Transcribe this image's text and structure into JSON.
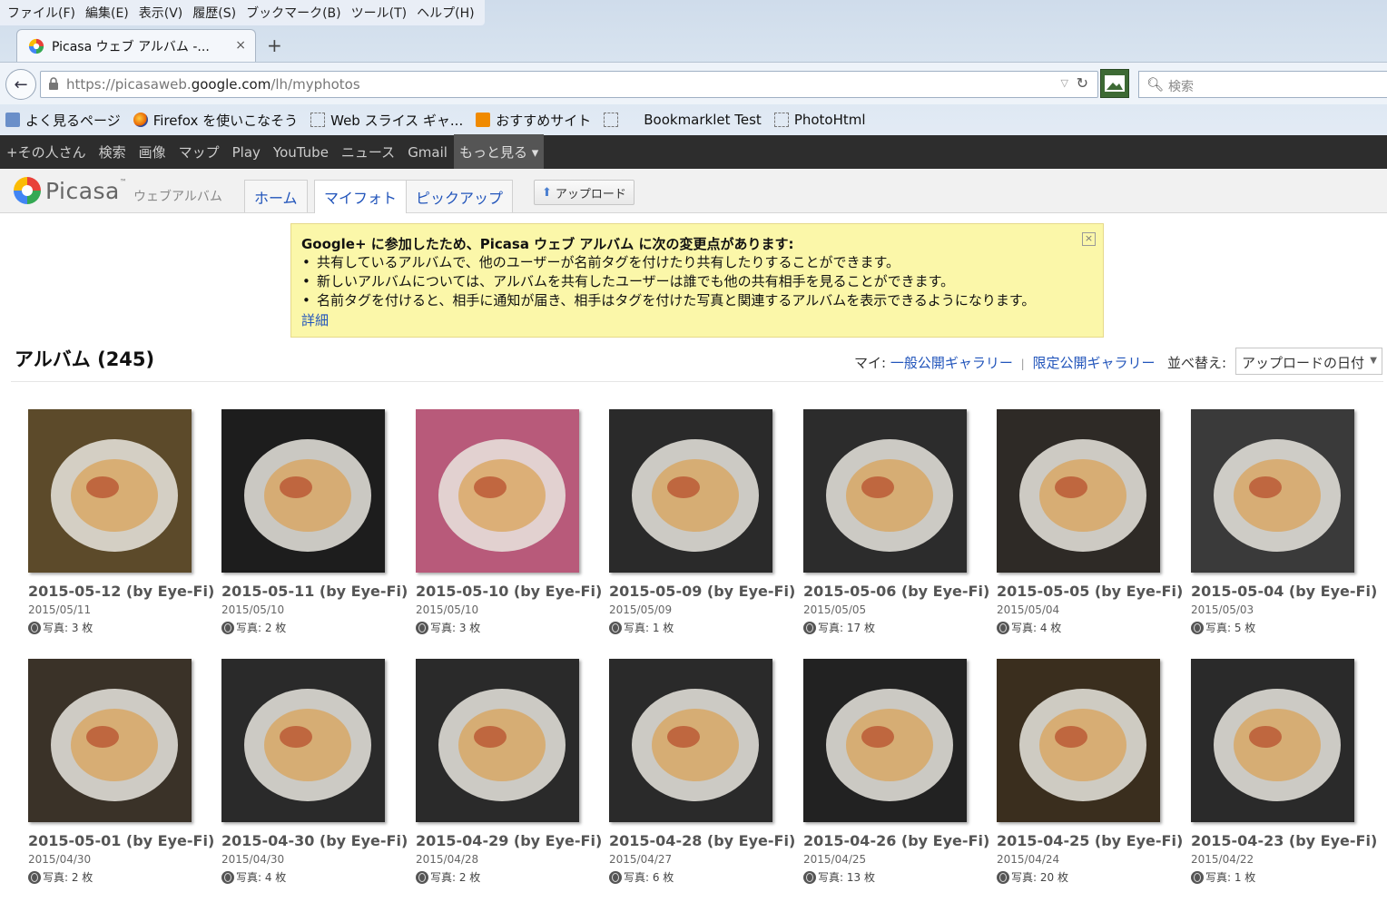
{
  "menubar": [
    "ファイル(F)",
    "編集(E)",
    "表示(V)",
    "履歴(S)",
    "ブックマーク(B)",
    "ツール(T)",
    "ヘルプ(H)"
  ],
  "tab": {
    "title": "Picasa ウェブ アルバム -...",
    "close": "×",
    "new": "+"
  },
  "nav": {
    "url_prefix": "https://picasaweb.",
    "url_domain": "google.com",
    "url_path": "/lh/myphotos",
    "search_placeholder": "検索",
    "back": "←",
    "reload": "↻",
    "dropdown": "▽"
  },
  "bookmarks": [
    "よく見るページ",
    "Firefox を使いこなそう",
    "Web スライス ギャ...",
    "おすすめサイト",
    "Bookmarklet Test",
    "PhotoHtml"
  ],
  "gbar": [
    "+その人さん",
    "検索",
    "画像",
    "マップ",
    "Play",
    "YouTube",
    "ニュース",
    "Gmail",
    "もっと見る ▾"
  ],
  "picasa": {
    "name": "Picasa",
    "tm": "™",
    "subtitle": "ウェブアルバム",
    "tabs": [
      "ホーム",
      "マイフォト",
      "ピックアップ"
    ],
    "upload": "アップロード"
  },
  "notice": {
    "title": "Google+ に参加したため、Picasa ウェブ アルバム に次の変更点があります:",
    "items": [
      "共有しているアルバムで、他のユーザーが名前タグを付けたり共有したりすることができます。",
      "新しいアルバムについては、アルバムを共有したユーザーは誰でも他の共有相手を見ることができます。",
      "名前タグを付けると、相手に通知が届き、相手はタグを付けた写真と関連するアルバムを表示できるようになります。"
    ],
    "link": "詳細",
    "close": "×"
  },
  "albums_header": {
    "title": "アルバム (245)",
    "my_label": "マイ:",
    "public_gallery": "一般公開ギャラリー",
    "sep": "|",
    "limited_gallery": "限定公開ギャラリー",
    "sort_label": "並べ替え:",
    "sort_value": "アップロードの日付",
    "sort_arrow": "▼"
  },
  "albums": [
    {
      "title": "2015-05-12 (by Eye-Fi)",
      "date": "2015/05/11",
      "count": "写真: 3 枚",
      "color": "#5c4a2a"
    },
    {
      "title": "2015-05-11 (by Eye-Fi)",
      "date": "2015/05/10",
      "count": "写真: 2 枚",
      "color": "#1d1d1d"
    },
    {
      "title": "2015-05-10 (by Eye-Fi)",
      "date": "2015/05/10",
      "count": "写真: 3 枚",
      "color": "#b85a7a"
    },
    {
      "title": "2015-05-09 (by Eye-Fi)",
      "date": "2015/05/09",
      "count": "写真: 1 枚",
      "color": "#2a2a2a"
    },
    {
      "title": "2015-05-06 (by Eye-Fi)",
      "date": "2015/05/05",
      "count": "写真: 17 枚",
      "color": "#2c2c2c"
    },
    {
      "title": "2015-05-05 (by Eye-Fi)",
      "date": "2015/05/04",
      "count": "写真: 4 枚",
      "color": "#2e2a26"
    },
    {
      "title": "2015-05-04 (by Eye-Fi)",
      "date": "2015/05/03",
      "count": "写真: 5 枚",
      "color": "#3a3a3a"
    },
    {
      "title": "2015-05-01 (by Eye-Fi)",
      "date": "2015/04/30",
      "count": "写真: 2 枚",
      "color": "#3a3228"
    },
    {
      "title": "2015-04-30 (by Eye-Fi)",
      "date": "2015/04/30",
      "count": "写真: 4 枚",
      "color": "#2a2a2a"
    },
    {
      "title": "2015-04-29 (by Eye-Fi)",
      "date": "2015/04/28",
      "count": "写真: 2 枚",
      "color": "#2a2a2a"
    },
    {
      "title": "2015-04-28 (by Eye-Fi)",
      "date": "2015/04/27",
      "count": "写真: 6 枚",
      "color": "#2a2a2a"
    },
    {
      "title": "2015-04-26 (by Eye-Fi)",
      "date": "2015/04/25",
      "count": "写真: 13 枚",
      "color": "#222222"
    },
    {
      "title": "2015-04-25 (by Eye-Fi)",
      "date": "2015/04/24",
      "count": "写真: 20 枚",
      "color": "#3a2e1e"
    },
    {
      "title": "2015-04-23 (by Eye-Fi)",
      "date": "2015/04/22",
      "count": "写真: 1 枚",
      "color": "#2a2a2a"
    }
  ]
}
